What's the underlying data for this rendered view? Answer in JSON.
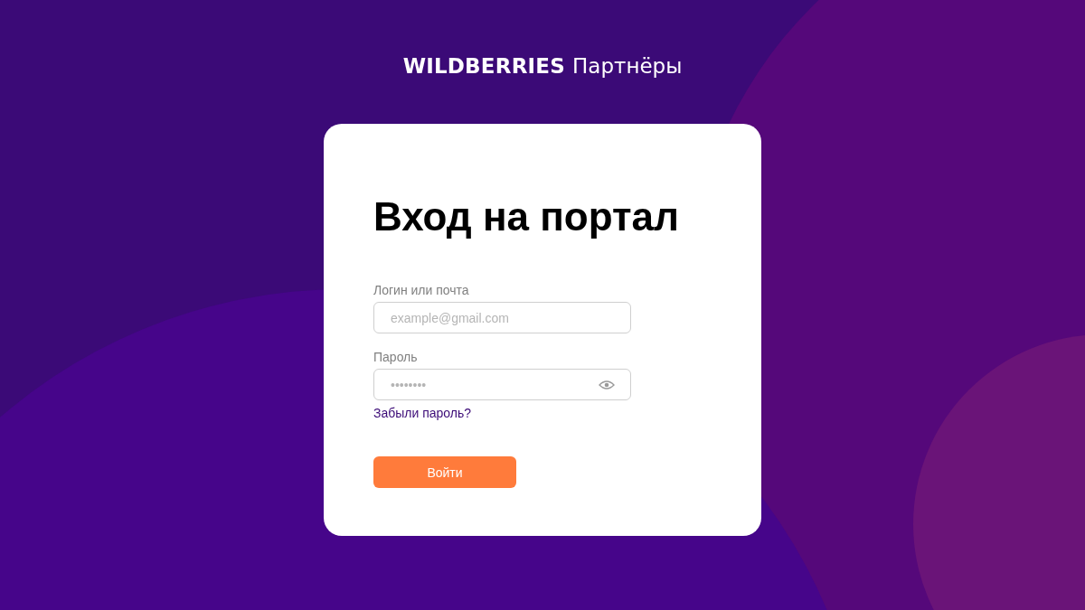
{
  "logo": {
    "brand": "WILDBERRIES",
    "product": "Партнёры"
  },
  "form": {
    "title": "Вход на портал",
    "fields": [
      {
        "kind": "text",
        "label": "Логин или почта",
        "placeholder": "example@gmail.com"
      },
      {
        "kind": "password",
        "label": "Пароль",
        "placeholder": "••••••••"
      }
    ],
    "forgot_link": "Забыли пароль?",
    "submit": "Войти"
  }
}
